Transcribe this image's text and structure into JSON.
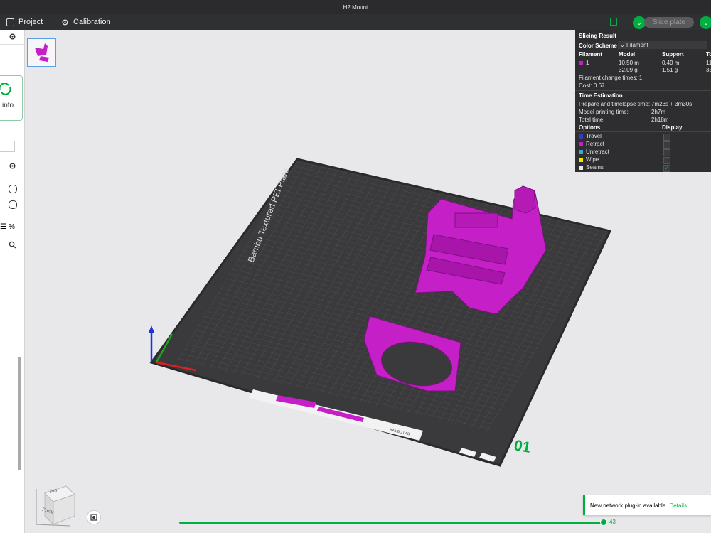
{
  "window": {
    "title": "H2 Mount"
  },
  "menu": {
    "project": "Project",
    "calibration": "Calibration"
  },
  "toolbar": {
    "slice_plate": "Slice plate"
  },
  "sidebar": {
    "info_label": "info"
  },
  "bed": {
    "label": "Bambu Textured PEI Plate",
    "plate_number": "01",
    "brand_strip": "BAMBU LAB"
  },
  "slicing_result": {
    "title": "Slicing Result",
    "color_scheme_label": "Color Scheme",
    "color_scheme_value": "Filament",
    "columns": [
      "Filament",
      "Model",
      "Support",
      "To"
    ],
    "filament_row": {
      "id": "1",
      "model_length": "10.50 m",
      "model_weight": "32.09 g",
      "support_length": "0.49 m",
      "support_weight": "1.51 g",
      "total_length": "11",
      "total_weight": "33",
      "color": "#c51fc7"
    },
    "filament_change": "Filament change times: 1",
    "cost": "Cost: 0.67",
    "time_title": "Time Estimation",
    "times": [
      {
        "label": "Prepare and timelapse time:",
        "value": "7m23s + 3m30s"
      },
      {
        "label": "Model printing time:",
        "value": "2h7m"
      },
      {
        "label": "Total time:",
        "value": "2h18m"
      }
    ],
    "options_title": "Options",
    "display_title": "Display",
    "options": [
      {
        "name": "Travel",
        "color": "#3a3ab8",
        "checked": false
      },
      {
        "name": "Retract",
        "color": "#c51fc7",
        "checked": false
      },
      {
        "name": "Unretract",
        "color": "#3fa7d6",
        "checked": false
      },
      {
        "name": "Wipe",
        "color": "#f2e600",
        "checked": false
      },
      {
        "name": "Seams",
        "color": "#e8e8e8",
        "checked": true
      }
    ]
  },
  "notification": {
    "text": "New network plug-in available.",
    "link": "Details"
  },
  "layer_slider": {
    "value": "43"
  },
  "view_cube": {
    "top": "Top",
    "front": "Front"
  },
  "colors": {
    "accent": "#00ae42",
    "filament": "#c51fc7",
    "plate": "#3a3a3c"
  }
}
